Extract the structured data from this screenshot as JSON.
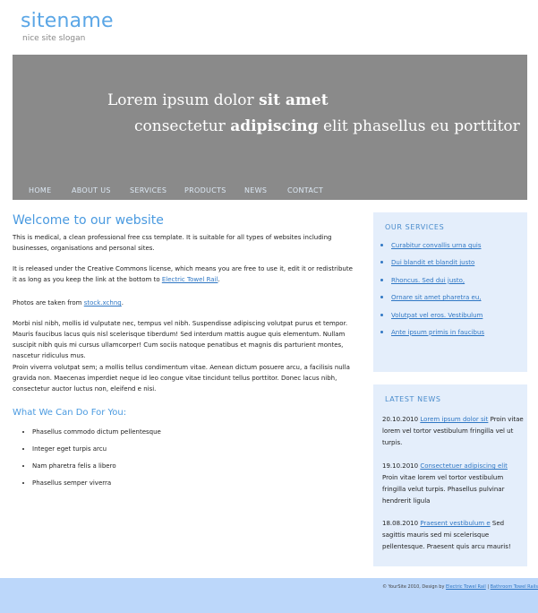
{
  "header": {
    "sitename": "sitename",
    "slogan": "nice site slogan"
  },
  "banner": {
    "line1_a": "Lorem ipsum dolor ",
    "line1_b": "sit amet",
    "line2_a": "consectetur ",
    "line2_b": "adipiscing",
    "line2_c": " elit phasellus eu porttitor"
  },
  "nav": [
    "HOME",
    "ABOUT US",
    "SERVICES",
    "PRODUCTS",
    "NEWS",
    "CONTACT"
  ],
  "main": {
    "title": "Welcome to our website",
    "p1": "This is medical, a clean professional free css template. It is suitable for all types of websites including businesses, organisations and personal sites.",
    "p2_a": "It is released under the Creative Commons license, which means you are free to use it, edit it or redistribute it as long as you keep the link at the bottom to ",
    "p2_link": "Electric Towel Rail",
    "p2_b": ".",
    "p3_a": "Photos are taken from ",
    "p3_link": "stock.xchng",
    "p3_b": ".",
    "p4": "Morbi nisl nibh, mollis id vulputate nec, tempus vel nibh. Suspendisse adipiscing volutpat purus et tempor. Mauris faucibus lacus quis nisl scelerisque tiberdum! Sed interdum mattis augue quis elementum. Nullam suscipit nibh quis mi cursus ullamcorper! Cum sociis natoque penatibus et magnis dis parturient montes, nascetur ridiculus mus.",
    "p5": "Proin viverra volutpat sem; a mollis tellus condimentum vitae. Aenean dictum posuere arcu, a facilisis nulla gravida non. Maecenas imperdiet neque id leo congue vitae tincidunt tellus porttitor. Donec lacus nibh, consectetur auctor luctus non, eleifend e nisi.",
    "what_title": "What We Can Do For You:",
    "what_list": [
      "Phasellus commodo dictum pellentesque",
      "Integer eget turpis arcu",
      "Nam pharetra felis a libero",
      "Phasellus semper viverra"
    ]
  },
  "services": {
    "title": "OUR SERVICES",
    "items": [
      "Curabitur convallis urna quis",
      "Dui blandit et blandit justo",
      "Rhoncus. Sed dui justo,",
      "Ornare sit amet pharetra eu,",
      "Volutpat vel eros. Vestibulum",
      "Ante ipsum primis in faucibus"
    ]
  },
  "news": {
    "title": "LATEST NEWS",
    "items": [
      {
        "date": "20.10.2010",
        "link": "Lorem ipsum dolor sit",
        "text": " Proin vitae lorem vel tortor vestibulum fringilla vel ut turpis."
      },
      {
        "date": "19.10.2010",
        "link": "Consectetuer adipiscing elit",
        "text": " Proin vitae lorem vel tortor vestibulum fringilla velut turpis. Phasellus pulvinar hendrerit ligula"
      },
      {
        "date": "18.08.2010",
        "link": "Praesent vestibulum e",
        "text": " Sed sagittis mauris sed mi scelerisque pellentesque. Praesent quis arcu mauris!"
      }
    ]
  },
  "footer": {
    "text": "© YourSite 2010, Design by ",
    "link1": "Electric Towel Rail",
    "sep": " | ",
    "link2": "Bathroom Towel Rails"
  }
}
